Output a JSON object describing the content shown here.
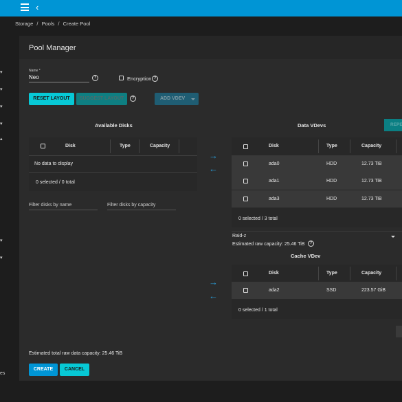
{
  "breadcrumb": [
    "Storage",
    "/",
    "Pools",
    "/",
    "Create Pool"
  ],
  "page_title": "Pool Manager",
  "name_field": {
    "label": "Name *",
    "value": "Neo"
  },
  "encryption_label": "Encryption",
  "buttons": {
    "reset_layout": "RESET LAYOUT",
    "suggest_layout": "SUGGEST LAYOUT",
    "add_vdev": "ADD VDEV",
    "repeat": "REPE",
    "create": "CREATE",
    "cancel": "CANCEL"
  },
  "available_disks": {
    "title": "Available Disks",
    "columns": [
      "Disk",
      "Type",
      "Capacity"
    ],
    "empty_text": "No data to display",
    "footer": "0 selected / 0 total",
    "filter_name_placeholder": "Filter disks by name",
    "filter_capacity_placeholder": "Filter disks by capacity"
  },
  "data_vdevs": {
    "title": "Data VDevs",
    "columns": [
      "Disk",
      "Type",
      "Capacity"
    ],
    "rows": [
      {
        "disk": "ada0",
        "type": "HDD",
        "capacity": "12.73 TiB"
      },
      {
        "disk": "ada1",
        "type": "HDD",
        "capacity": "12.73 TiB"
      },
      {
        "disk": "ada3",
        "type": "HDD",
        "capacity": "12.73 TiB"
      }
    ],
    "footer": "0 selected / 3 total",
    "layout": "Raid-z",
    "estimated": "Estimated raw capacity: 25.46 TiB"
  },
  "cache_vdev": {
    "title": "Cache VDev",
    "columns": [
      "Disk",
      "Type",
      "Capacity"
    ],
    "rows": [
      {
        "disk": "ada2",
        "type": "SSD",
        "capacity": "223.57 GiB"
      }
    ],
    "footer": "0 selected / 1 total"
  },
  "total_capacity": "Estimated total raw data capacity: 25.46 TiB",
  "sidebar_partial_text": "es",
  "colors": {
    "accent": "#0095d5",
    "cyan": "#07c9d6",
    "arrow": "#2a9bd6",
    "background": "#1d1d1d",
    "card": "#2b2b2b"
  }
}
